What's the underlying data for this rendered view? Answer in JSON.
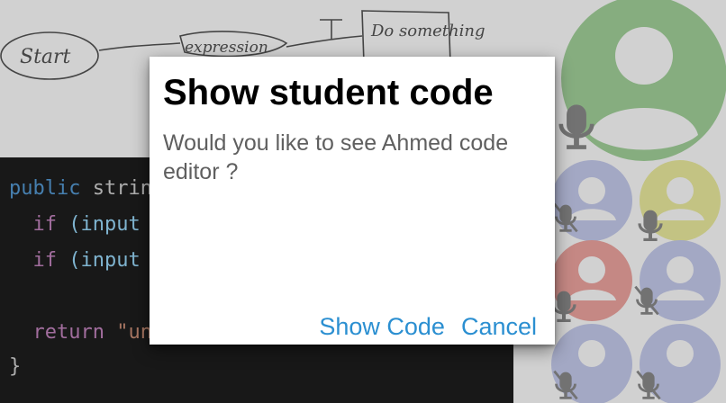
{
  "whiteboard": {
    "nodes": [
      "Start",
      "expression",
      "T",
      "Do something"
    ]
  },
  "editor": {
    "lines": [
      {
        "indent": "",
        "keyword": "public",
        "rest": " strin"
      },
      {
        "indent": "  ",
        "keyword": "if",
        "rest": " (input"
      },
      {
        "indent": "  ",
        "keyword": "if",
        "rest": " (input"
      },
      {
        "indent": "",
        "keyword": "",
        "rest": ""
      },
      {
        "indent": "  ",
        "keyword": "return",
        "rest": " \"un"
      },
      {
        "indent": "",
        "keyword": "",
        "rest": "}"
      }
    ]
  },
  "participants": [
    {
      "avatar": "#a4d49c",
      "muted": false
    },
    {
      "avatar": "#c7cdf0",
      "muted": true
    },
    {
      "avatar": "#eeeea0",
      "muted": false
    },
    {
      "avatar": "#f1a7a2",
      "muted": true
    },
    {
      "avatar": "#c7cdf0",
      "muted": true
    },
    {
      "avatar": "#c7cdf0",
      "muted": true
    },
    {
      "avatar": "#c7cdf0",
      "muted": true
    }
  ],
  "dialog": {
    "title": "Show student code",
    "message": "Would you like to see Ahmed code editor ?",
    "primary_label": "Show Code",
    "secondary_label": "Cancel",
    "accent": "#2b8fd1"
  }
}
